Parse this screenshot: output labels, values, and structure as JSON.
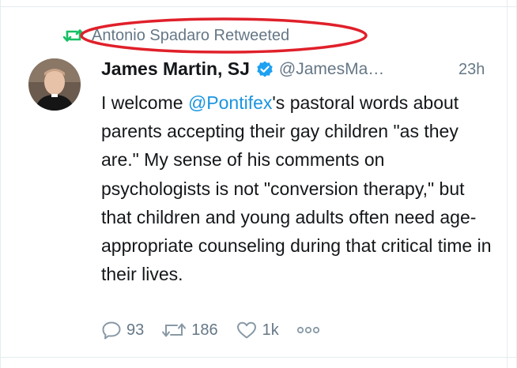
{
  "retweet": {
    "label": "Antonio Spadaro Retweeted"
  },
  "tweet": {
    "author_name": "James Martin, SJ",
    "handle": "@JamesMa…",
    "time": "23h",
    "text_before": "I welcome ",
    "mention": "@Pontifex",
    "text_after": "'s pastoral words about parents accepting their gay children \"as they are.\" My sense of his comments on psychologists is not \"conversion therapy,\" but that children and young adults often need age-appropriate counseling during that critical time in their lives."
  },
  "actions": {
    "reply_count": "93",
    "retweet_count": "186",
    "like_count": "1k"
  },
  "icons": {
    "retweet_color": "#17bf63",
    "verified_color": "#1da1f2",
    "action_color": "#8899a6",
    "annotation_color": "#e0202a"
  }
}
